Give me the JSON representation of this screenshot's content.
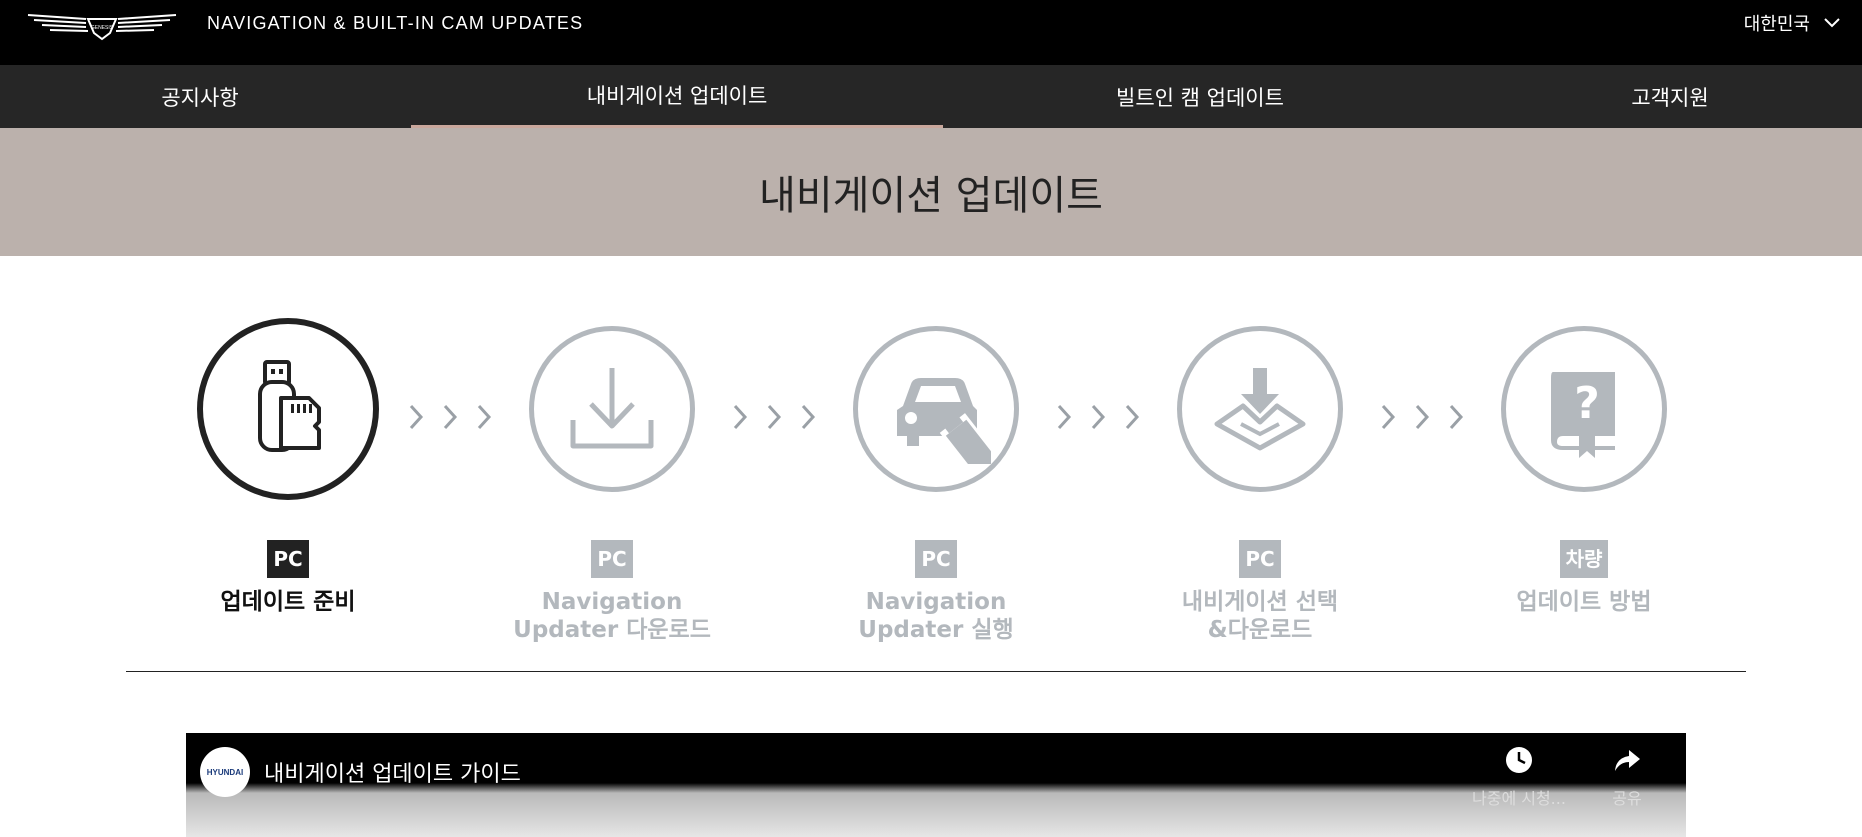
{
  "header": {
    "title": "NAVIGATION & BUILT-IN CAM UPDATES",
    "logo_text": "GENESIS",
    "region": "대한민국",
    "region_icon": "chevron-down-icon"
  },
  "nav": {
    "items": [
      {
        "label": "공지사항"
      },
      {
        "label": "내비게이션 업데이트",
        "active": true
      },
      {
        "label": "빌트인 캠 업데이트"
      },
      {
        "label": "고객지원"
      }
    ]
  },
  "banner": {
    "title": "내비게이션 업데이트"
  },
  "steps": [
    {
      "badge": "PC",
      "label_line1": "업데이트 준비",
      "label_line2": "",
      "icon": "usb-sdcard-icon",
      "active": true
    },
    {
      "badge": "PC",
      "label_line1": "Navigation",
      "label_line2": "Updater 다운로드",
      "icon": "download-icon"
    },
    {
      "badge": "PC",
      "label_line1": "Navigation",
      "label_line2": "Updater 실행",
      "icon": "car-usb-icon"
    },
    {
      "badge": "PC",
      "label_line1": "내비게이션 선택",
      "label_line2": "&다운로드",
      "icon": "map-download-icon"
    },
    {
      "badge": "차량",
      "label_line1": "업데이트 방법",
      "label_line2": "",
      "icon": "help-book-icon"
    }
  ],
  "video": {
    "channel": "HYUNDAI",
    "title": "내비게이션 업데이트 가이드",
    "watch_later": "나중에 시청...",
    "share": "공유"
  },
  "colors": {
    "header_bg": "#000000",
    "nav_bg": "#262626",
    "nav_active_underline": "#c9a79c",
    "banner_bg": "#bbb1ac",
    "step_inactive": "#b3b8bd",
    "step_active": "#222222"
  }
}
